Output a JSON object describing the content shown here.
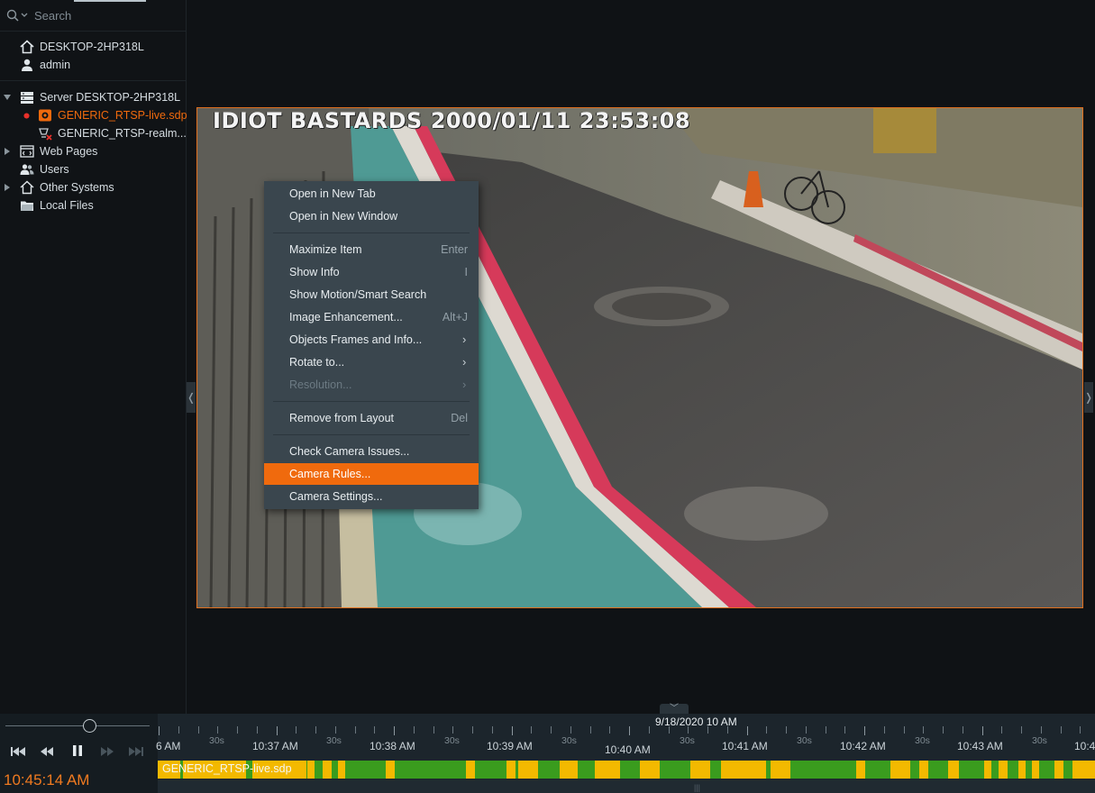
{
  "search": {
    "placeholder": "Search"
  },
  "system": {
    "name": "DESKTOP-2HP318L",
    "user": "admin"
  },
  "tree": {
    "server": "Server DESKTOP-2HP318L",
    "camera_live": "GENERIC_RTSP-live.sdp",
    "camera_realm": "GENERIC_RTSP-realm...",
    "web_pages": "Web Pages",
    "users": "Users",
    "other_systems": "Other Systems",
    "local_files": "Local Files"
  },
  "camera": {
    "osd": "IDIOT BASTARDS 2000/01/11 23:53:08"
  },
  "menu": {
    "items": [
      {
        "label": "Open in New Tab",
        "shortcut": ""
      },
      {
        "label": "Open in New Window",
        "shortcut": ""
      },
      {
        "label": "Maximize Item",
        "shortcut": "Enter"
      },
      {
        "label": "Show Info",
        "shortcut": "I"
      },
      {
        "label": "Show Motion/Smart Search",
        "shortcut": ""
      },
      {
        "label": "Image Enhancement...",
        "shortcut": "Alt+J"
      },
      {
        "label": "Objects Frames and Info...",
        "shortcut": ""
      },
      {
        "label": "Rotate to...",
        "shortcut": ""
      },
      {
        "label": "Resolution...",
        "shortcut": ""
      },
      {
        "label": "Remove from Layout",
        "shortcut": "Del"
      },
      {
        "label": "Check Camera Issues...",
        "shortcut": ""
      },
      {
        "label": "Camera Rules...",
        "shortcut": ""
      },
      {
        "label": "Camera Settings...",
        "shortcut": ""
      }
    ]
  },
  "player": {
    "time": "10:45:14 AM",
    "volume_fraction": 0.58
  },
  "timeline": {
    "date": "9/18/2020 10 AM",
    "labels": [
      "6 AM",
      "10:37 AM",
      "10:38 AM",
      "10:39 AM",
      "10:40 AM",
      "10:41 AM",
      "10:42 AM",
      "10:43 AM",
      "10:4"
    ],
    "sub_label": "30s",
    "recording_name": "GENERIC_RTSP-live.sdp"
  },
  "colors": {
    "accent": "#f06a0d",
    "recorded": "#3a9c1e",
    "motion": "#f3b900"
  }
}
